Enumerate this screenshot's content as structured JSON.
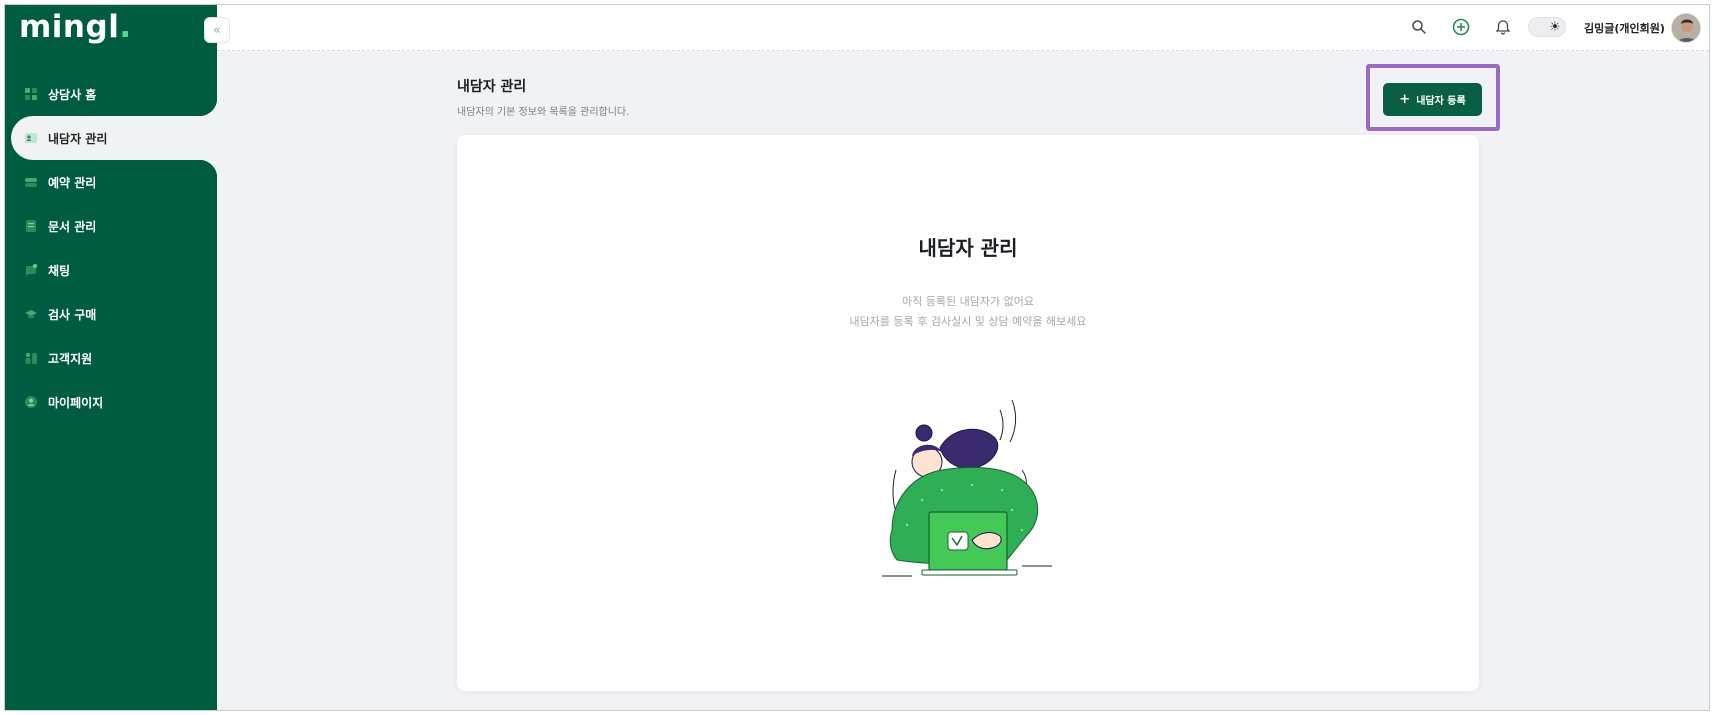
{
  "app": {
    "logo_text": "mingl",
    "logo_dot": "."
  },
  "sidebar": {
    "collapse_label": "«",
    "items": [
      {
        "label": "상담사 홈",
        "icon": "home-icon",
        "active": false
      },
      {
        "label": "내담자 관리",
        "icon": "client-card-icon",
        "active": true
      },
      {
        "label": "예약 관리",
        "icon": "calendar-toggle-icon",
        "active": false
      },
      {
        "label": "문서 관리",
        "icon": "document-icon",
        "active": false
      },
      {
        "label": "채팅",
        "icon": "chat-icon",
        "active": false
      },
      {
        "label": "검사 구매",
        "icon": "graduation-cap-icon",
        "active": false
      },
      {
        "label": "고객지원",
        "icon": "support-icon",
        "active": false
      },
      {
        "label": "마이페이지",
        "icon": "user-icon",
        "active": false
      }
    ]
  },
  "topbar": {
    "icons": [
      "search-icon",
      "add-circle-icon",
      "bell-icon"
    ],
    "theme_toggle_icon": "sun-icon",
    "user_name": "김밍글(개인회원)"
  },
  "page": {
    "title": "내담자 관리",
    "subtitle": "내담자의 기본 정보와 목록을 관리합니다.",
    "add_button_label": "내담자 등록",
    "add_button_icon": "plus-icon"
  },
  "empty_state": {
    "title": "내담자 관리",
    "line1": "아직 등록된 내담자가 없어요",
    "line2": "내담자를 등록 후 검사실시 및 상담 예약을 해보세요"
  },
  "colors": {
    "sidebar": "#005c40",
    "primary_button": "#0a5e44",
    "accent_green": "#58d68d",
    "highlight": "#9b6bc4",
    "background": "#f1f2f5"
  }
}
